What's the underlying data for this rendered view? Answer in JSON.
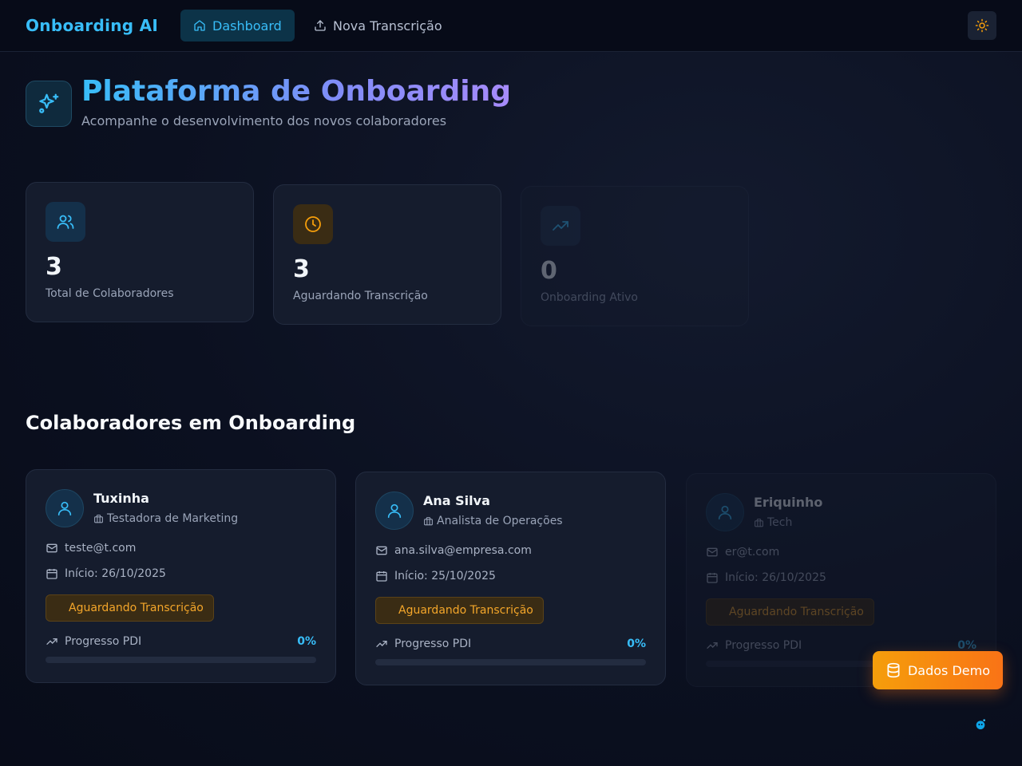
{
  "nav": {
    "brand": "Onboarding AI",
    "items": [
      {
        "label": "Dashboard",
        "active": true
      },
      {
        "label": "Nova Transcrição",
        "active": false
      }
    ]
  },
  "header": {
    "title": "Plataforma de Onboarding",
    "subtitle": "Acompanhe o desenvolvimento dos novos colaboradores"
  },
  "stats": [
    {
      "value": "3",
      "label": "Total de Colaboradores",
      "icon": "users-icon",
      "color": "#38bdf8"
    },
    {
      "value": "3",
      "label": "Aguardando Transcrição",
      "icon": "clock-icon",
      "color": "#f59e0b"
    },
    {
      "value": "0",
      "label": "Onboarding Ativo",
      "icon": "trending-up-icon",
      "color": "#38bdf8"
    }
  ],
  "section": {
    "title": "Colaboradores em Onboarding"
  },
  "collaborators": [
    {
      "name": "Tuxinha",
      "role": "Testadora de Marketing",
      "email": "teste@t.com",
      "start": "Início: 26/10/2025",
      "status": "Aguardando Transcrição",
      "pdi_label": "Progresso PDI",
      "pdi_value": "0%",
      "progress": 0
    },
    {
      "name": "Ana Silva",
      "role": "Analista de Operações",
      "email": "ana.silva@empresa.com",
      "start": "Início: 25/10/2025",
      "status": "Aguardando Transcrição",
      "pdi_label": "Progresso PDI",
      "pdi_value": "0%",
      "progress": 0
    },
    {
      "name": "Eriquinho",
      "role": "Tech",
      "email": "er@t.com",
      "start": "Início: 26/10/2025",
      "status": "Aguardando Transcrição",
      "pdi_label": "Progresso PDI",
      "pdi_value": "0%",
      "progress": 0
    }
  ],
  "demo_button": {
    "label": "Dados Demo"
  },
  "colors": {
    "accent": "#38bdf8",
    "warning": "#f59e0b",
    "background": "#0b1020"
  }
}
